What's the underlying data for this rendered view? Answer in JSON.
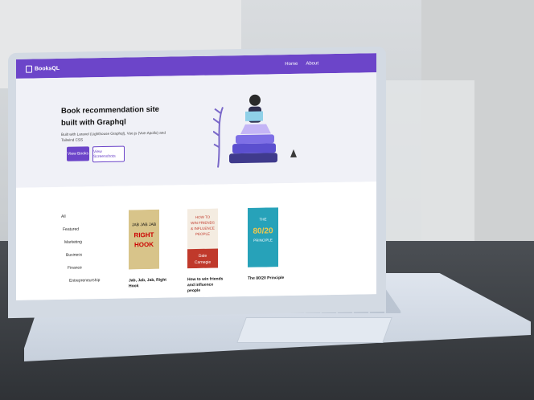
{
  "app": {
    "brand": "BooksQL"
  },
  "nav": {
    "links": [
      "Home",
      "About"
    ]
  },
  "hero": {
    "title": "Book recommendation site built with Graphql",
    "description": "Built with Laravel (Lighthouse Graphql), Vue.js (Vue-Apollo) and Tailwind CSS",
    "primary_button": "View Books",
    "secondary_button": "View Screenshots"
  },
  "categories": [
    "All",
    "Featured",
    "Marketing",
    "Business",
    "Finance",
    "Entrepreneurship"
  ],
  "books": [
    {
      "title": "Jab, Jab, Jab, Right Hook",
      "cover_lines": [
        "JAB JAB JAB",
        "RIGHT",
        "HOOK"
      ]
    },
    {
      "title": "How to win friends and influence people",
      "cover_lines": [
        "HOW TO",
        "WIN FRIENDS",
        "& INFLUENCE",
        "PEOPLE",
        "Dale",
        "Carnegie"
      ]
    },
    {
      "title": "The 80/20 Principle",
      "cover_lines": [
        "THE",
        "80/20",
        "PRINCIPLE"
      ]
    }
  ],
  "colors": {
    "accent": "#6c45c9"
  }
}
